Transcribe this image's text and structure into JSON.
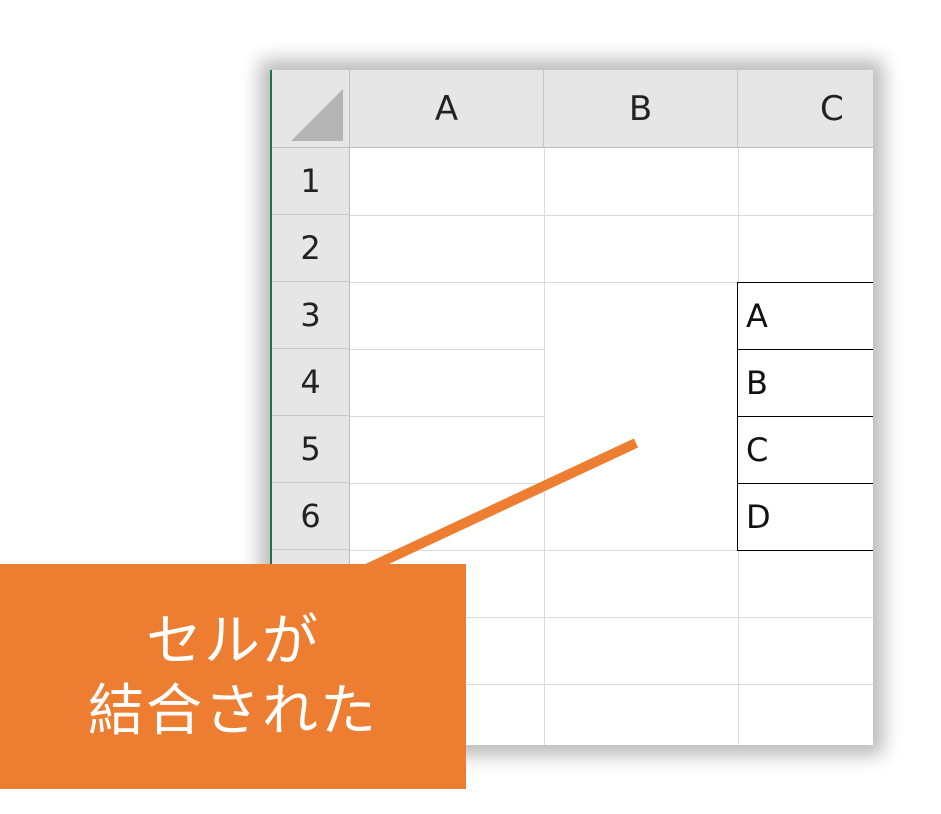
{
  "sheet": {
    "columns": [
      "A",
      "B",
      "C"
    ],
    "rows": [
      "1",
      "2",
      "3",
      "4",
      "5",
      "6"
    ],
    "c_cells": [
      "A",
      "B",
      "C",
      "D"
    ]
  },
  "callout": {
    "line1": "セルが",
    "line2": "結合された",
    "color": "#ed7d31"
  },
  "colors": {
    "header_bg": "#e6e6e6",
    "gridline": "#dadada",
    "accent": "#217346"
  }
}
